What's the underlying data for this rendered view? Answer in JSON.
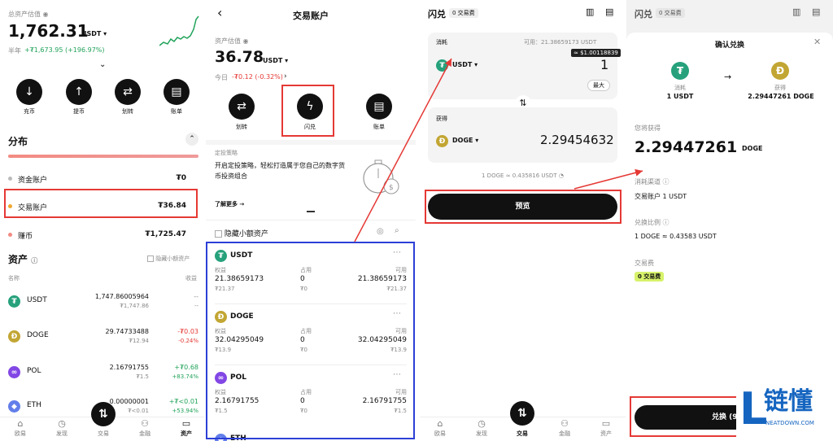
{
  "p1": {
    "label": "总资产估值",
    "amount": "1,762.31",
    "currency": "USDT ▾",
    "half_year": "半年",
    "change": "+₮1,673.95 (+196.97%)",
    "chevron": "⌄",
    "actions": [
      "充币",
      "提币",
      "划转",
      "账单"
    ],
    "section_title": "分布",
    "accounts": [
      {
        "name": "资金账户",
        "value": "₮0"
      },
      {
        "name": "交易账户",
        "value": "₮36.84"
      },
      {
        "name": "赚币",
        "value": "₮1,725.47"
      }
    ],
    "assets_title": "资产",
    "hide_small": "隐藏小额资产",
    "col_name": "名称",
    "col_balance": "",
    "col_pnl": "收益",
    "assets": [
      {
        "name": "USDT",
        "bal": "1,747.86005964",
        "sub": "₮1,747.86",
        "pnl": "--",
        "pnl2": "--"
      },
      {
        "name": "DOGE",
        "bal": "29.74733488",
        "sub": "₮12.94",
        "pnl": "-₮0.03",
        "pnl2": "-0.24%"
      },
      {
        "name": "POL",
        "bal": "2.16791755",
        "sub": "₮1.5",
        "pnl": "+₮0.68",
        "pnl2": "+83.74%"
      },
      {
        "name": "ETH",
        "bal": "0.00000001",
        "sub": "₮<0.01",
        "pnl": "+₮<0.01",
        "pnl2": "+53.94%"
      }
    ],
    "nav": [
      "欧易",
      "发现",
      "交易",
      "金融",
      "资产"
    ]
  },
  "p2": {
    "title": "交易账户",
    "back": "‹",
    "label": "资产估值",
    "amount": "36.78",
    "currency": "USDT ▾",
    "today": "今日",
    "today_change": "-₮0.12 (-0.32%)",
    "actions": [
      "划转",
      "闪兑",
      "账单"
    ],
    "promo_tag": "定投策略",
    "promo_text": "开启定投策略，轻松打造属于您自己的数字货币投资组合",
    "promo_more": "了解更多 →",
    "hide_small": "隐藏小额资产",
    "coins": [
      {
        "name": "USDT",
        "equity_l": "权益",
        "equity": "21.38659173",
        "eq_sub": "₮21.37",
        "occ_l": "占用",
        "occ": "0",
        "occ_sub": "₮0",
        "avail_l": "可用",
        "avail": "21.38659173",
        "av_sub": "₮21.37"
      },
      {
        "name": "DOGE",
        "equity_l": "权益",
        "equity": "32.04295049",
        "eq_sub": "₮13.9",
        "occ_l": "占用",
        "occ": "0",
        "occ_sub": "₮0",
        "avail_l": "可用",
        "avail": "32.04295049",
        "av_sub": "₮13.9"
      },
      {
        "name": "POL",
        "equity_l": "权益",
        "equity": "2.16791755",
        "eq_sub": "₮1.5",
        "occ_l": "占用",
        "occ": "0",
        "occ_sub": "₮0",
        "avail_l": "可用",
        "avail": "2.16791755",
        "av_sub": "₮1.5"
      }
    ],
    "eth_partial": "ETH"
  },
  "p3": {
    "title": "闪兑",
    "badge": "0 交易费",
    "spend": "消耗",
    "available": "可用：21.38659173 USDT",
    "from_coin": "USDT ▾",
    "tooltip": "≈ $1.00118839",
    "from_amount": "1",
    "max": "最大",
    "receive": "获得",
    "to_coin": "DOGE ▾",
    "to_amount": "2.29454632",
    "rate": "1 DOGE ≈ 0.435816 USDT",
    "preview": "预览",
    "nav": [
      "欧易",
      "发现",
      "交易",
      "金融",
      "资产"
    ]
  },
  "p4": {
    "title": "闪兑",
    "badge": "0 交易费",
    "sheet_title": "确认兑换",
    "from_label": "消耗",
    "from_value": "1 USDT",
    "to_label": "获得",
    "to_value": "2.29447261 DOGE",
    "you_get": "您将获得",
    "amount": "2.29447261",
    "amount_unit": "DOGE",
    "channel_label": "消耗渠道",
    "channel_value": "交易账户 1 USDT",
    "ratio_label": "兑换比例",
    "ratio_value": "1 DOGE ≈ 0.43583 USDT",
    "fee_label": "交易费",
    "fee_badge": "0 交易费",
    "confirm": "兑换 (9"
  },
  "watermark": {
    "name": "链懂",
    "domain": "NEATDOWN.COM",
    "letter": "L"
  },
  "colors": {
    "accent": "#e53935",
    "box_blue": "#2c3fd6",
    "usdt": "#26a17b",
    "doge": "#c2a633",
    "pol": "#8247e5",
    "eth": "#627eea"
  }
}
